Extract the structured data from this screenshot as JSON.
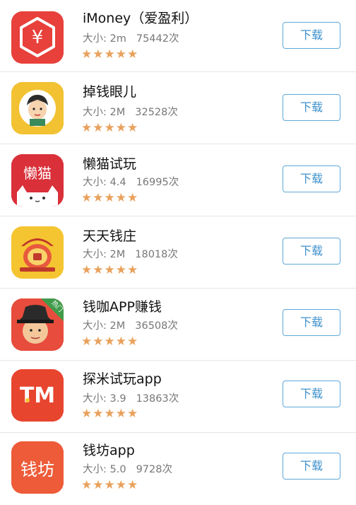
{
  "colors": {
    "accent": "#3f91cc",
    "star": "#e9a15c",
    "divider": "#e6e6e6"
  },
  "apps": [
    {
      "name": "iMoney（爱盈利）",
      "size_label": "大小:",
      "size": "2m",
      "count": "75442次",
      "rating": 5,
      "stars": "★★★★★",
      "icon": "yen-hexagon-icon",
      "download_label": "下载"
    },
    {
      "name": "掉钱眼儿",
      "size_label": "大小:",
      "size": "2M",
      "count": "32528次",
      "rating": 5,
      "stars": "★★★★★",
      "icon": "face-avatar-icon",
      "download_label": "下载"
    },
    {
      "name": "懒猫试玩",
      "size_label": "大小:",
      "size": "4.4",
      "count": "16995次",
      "rating": 5,
      "stars": "★★★★★",
      "icon": "lazy-cat-icon",
      "icon_text": "懒猫",
      "download_label": "下载"
    },
    {
      "name": "天天钱庄",
      "size_label": "大小:",
      "size": "2M",
      "count": "18018次",
      "rating": 5,
      "stars": "★★★★★",
      "icon": "money-bank-icon",
      "download_label": "下载"
    },
    {
      "name": "钱咖APP赚钱",
      "size_label": "大小:",
      "size": "2M",
      "count": "36508次",
      "rating": 5,
      "stars": "★★★★★",
      "icon": "hat-man-icon",
      "badge": "热门",
      "download_label": "下载"
    },
    {
      "name": "探米试玩app",
      "size_label": "大小:",
      "size": "3.9",
      "count": "13863次",
      "rating": 5,
      "stars": "★★★★★",
      "icon": "tm-logo-icon",
      "icon_text": "TM",
      "download_label": "下载"
    },
    {
      "name": "钱坊app",
      "size_label": "大小:",
      "size": "5.0",
      "count": "9728次",
      "rating": 5,
      "stars": "★★★★★",
      "icon": "qianfang-logo-icon",
      "icon_text": "钱坊",
      "download_label": "下载"
    }
  ]
}
